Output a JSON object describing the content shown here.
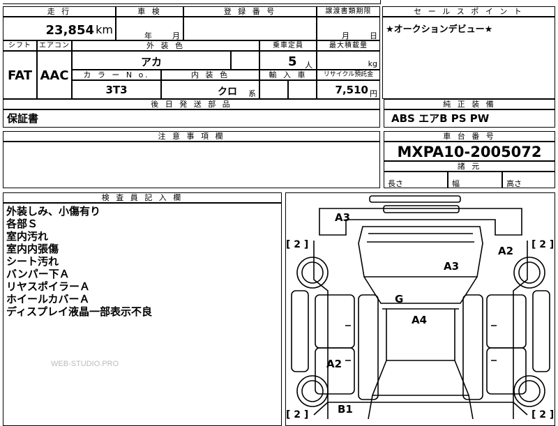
{
  "top_fragment": "…",
  "mileage": {
    "label": "走 行",
    "value": "23,854",
    "unit": "km"
  },
  "shaken": {
    "label": "車 検",
    "year_unit": "年",
    "month_unit": "月"
  },
  "registration": {
    "label": "登 録 番 号"
  },
  "transfer_deadline": {
    "label": "譲渡書類期限",
    "month_unit": "月",
    "day_unit": "日"
  },
  "sales_point": {
    "label": "セ ー ル ス ポ イ ン ト",
    "text": "★オークションデビュー★"
  },
  "shift": {
    "label": "シフト",
    "value": "FAT"
  },
  "aircon": {
    "label": "エアコン",
    "value": "AAC"
  },
  "exterior_color": {
    "label": "外 装 色",
    "value": "アカ"
  },
  "capacity": {
    "label": "乗車定員",
    "value": "5",
    "unit": "人"
  },
  "max_load": {
    "label": "最大積載量",
    "unit": "kg"
  },
  "color_no": {
    "label": "カ ラ ー N o.",
    "value": "3T3"
  },
  "interior_color": {
    "label": "内 装 色",
    "value": "クロ",
    "suffix": "系"
  },
  "import": {
    "label": "輸 入 車"
  },
  "recycle": {
    "label": "リサイクル預託金",
    "value": "7,510",
    "unit": "円"
  },
  "later_parts": {
    "label": "後 日 発 送 部 品",
    "value": "保証書"
  },
  "equipment": {
    "label": "純 正 装 備",
    "value": "ABS エアB PS PW"
  },
  "caution": {
    "label": "注 意 事 項 欄"
  },
  "chassis": {
    "label": "車 台 番 号",
    "value": "MXPA10-2005072"
  },
  "dimensions": {
    "label": "諸 元",
    "length": "長さ",
    "width": "幅",
    "height": "高さ"
  },
  "inspector": {
    "label": "検 査 員 記 入 欄",
    "lines": [
      "外装しみ、小傷有り",
      "各部Ｓ",
      "室内汚れ",
      "室内内張傷",
      "シート汚れ",
      "バンパー下Ａ",
      "リヤスポイラーＡ",
      "ホイールカバーＡ",
      "ディスプレイ液晶一部表示不良"
    ]
  },
  "watermark": "WEB-STUDIO.PRO",
  "diagram": {
    "marks": {
      "front_bumper": "A3",
      "right_front_fender": "A2",
      "hood": "A3",
      "windshield": "G",
      "roof": "A4",
      "left_rear_door": "A2",
      "rear_bumper": "B1"
    },
    "brackets": {
      "fl": "[ 2 ]",
      "fr": "[ 2 ]",
      "rl": "[ 2 ]",
      "rr": "[ 2 ]"
    }
  }
}
